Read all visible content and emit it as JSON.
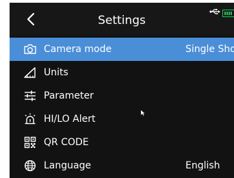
{
  "header": {
    "title": "Settings",
    "back_icon": "chevron-left-icon",
    "status_icons": [
      "usb-icon",
      "battery-icon"
    ],
    "accent": "#22c55e"
  },
  "menu": {
    "selected_color": "#4a8ed8",
    "items": [
      {
        "label": "Camera mode",
        "value": "Single Sho",
        "icon": "camera-icon",
        "selected": true
      },
      {
        "label": "Units",
        "value": "",
        "icon": "ruler-icon",
        "selected": false
      },
      {
        "label": "Parameter",
        "value": "",
        "icon": "sliders-icon",
        "selected": false
      },
      {
        "label": "HI/LO Alert",
        "value": "",
        "icon": "alert-lamp-icon",
        "selected": false
      },
      {
        "label": "QR CODE",
        "value": "",
        "icon": "qr-code-icon",
        "selected": false
      },
      {
        "label": "Language",
        "value": "English",
        "icon": "globe-icon",
        "selected": false
      }
    ]
  }
}
